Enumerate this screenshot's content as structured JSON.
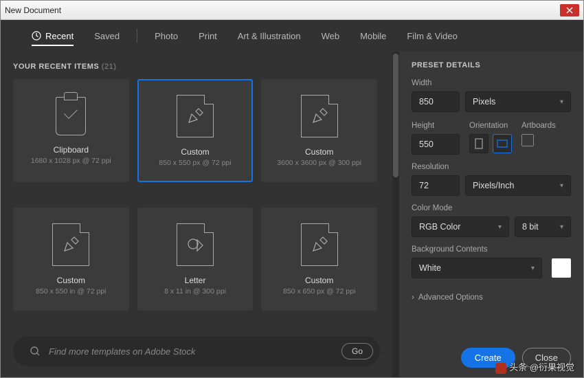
{
  "window": {
    "title": "New Document"
  },
  "tabs": {
    "recent": "Recent",
    "saved": "Saved",
    "photo": "Photo",
    "print": "Print",
    "art": "Art & Illustration",
    "web": "Web",
    "mobile": "Mobile",
    "film": "Film & Video"
  },
  "recent_header": {
    "label": "YOUR RECENT ITEMS",
    "count": "(21)"
  },
  "presets": [
    {
      "name": "Clipboard",
      "dims": "1680 x 1028 px @ 72 ppi",
      "icon": "clipboard"
    },
    {
      "name": "Custom",
      "dims": "850 x 550 px @ 72 ppi",
      "icon": "pencil-ruler",
      "selected": true
    },
    {
      "name": "Custom",
      "dims": "3600 x 3600 px @ 300 ppi",
      "icon": "pencil-ruler"
    },
    {
      "name": "Custom",
      "dims": "850 x 550 in @ 72 ppi",
      "icon": "pencil-ruler"
    },
    {
      "name": "Letter",
      "dims": "8 x 11 in @ 300 ppi",
      "icon": "letter"
    },
    {
      "name": "Custom",
      "dims": "850 x 650 px @ 72 ppi",
      "icon": "pencil-ruler"
    }
  ],
  "search": {
    "placeholder": "Find more templates on Adobe Stock",
    "go": "Go"
  },
  "details": {
    "heading": "PRESET DETAILS",
    "width_label": "Width",
    "width_value": "850",
    "unit_value": "Pixels",
    "height_label": "Height",
    "height_value": "550",
    "orientation_label": "Orientation",
    "artboards_label": "Artboards",
    "resolution_label": "Resolution",
    "resolution_value": "72",
    "resolution_unit": "Pixels/Inch",
    "colormode_label": "Color Mode",
    "colormode_value": "RGB Color",
    "bitdepth_value": "8 bit",
    "bg_label": "Background Contents",
    "bg_value": "White",
    "bg_color": "#ffffff",
    "advanced": "Advanced Options"
  },
  "buttons": {
    "create": "Create",
    "close": "Close"
  },
  "watermark": "头条 @衍果视觉"
}
